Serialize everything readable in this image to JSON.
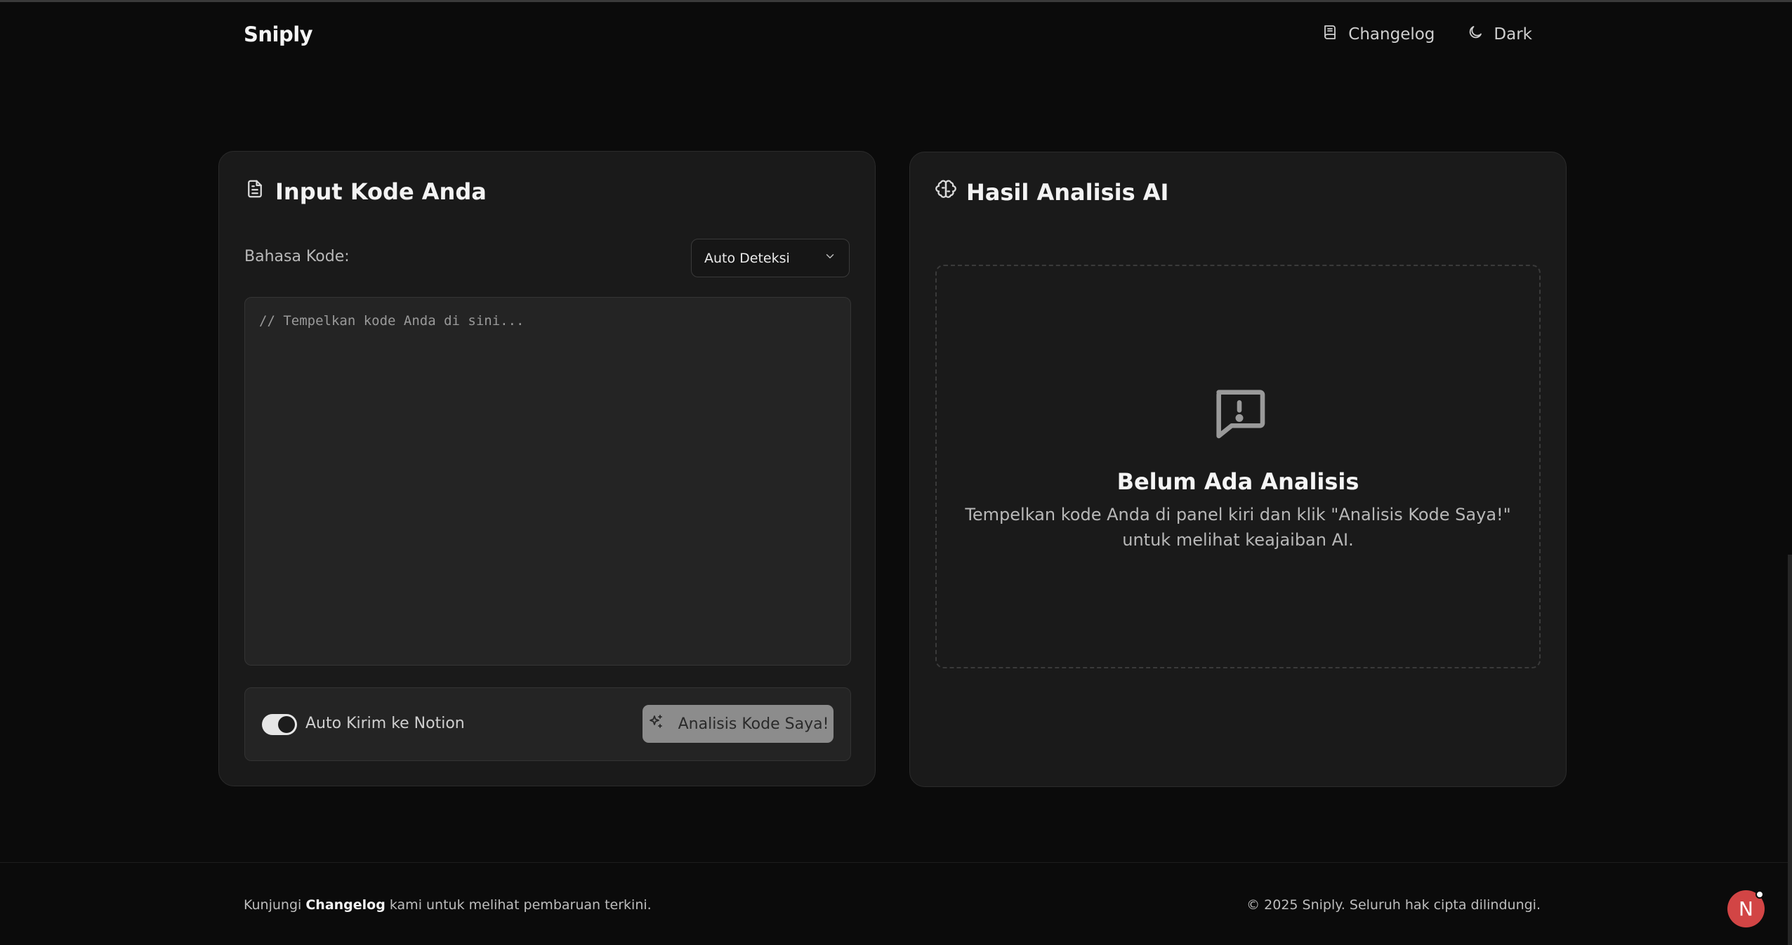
{
  "header": {
    "logo": "Sniply",
    "nav": [
      {
        "label": "Changelog",
        "icon": "book-icon"
      },
      {
        "label": "Dark",
        "icon": "moon-icon"
      }
    ]
  },
  "input_panel": {
    "title": "Input Kode Anda",
    "title_icon": "document-icon",
    "language_label": "Bahasa Kode:",
    "language_selected": "Auto Deteksi",
    "code_placeholder": "// Tempelkan kode Anda di sini...",
    "code_value": "",
    "toggle": {
      "label": "Auto Kirim ke Notion",
      "on": true
    },
    "analyze_button": "Analisis Kode Saya!"
  },
  "result_panel": {
    "title": "Hasil Analisis AI",
    "title_icon": "brain-icon",
    "empty_title": "Belum Ada Analisis",
    "empty_description": "Tempelkan kode Anda di panel kiri dan klik \"Analisis Kode Saya!\" untuk melihat keajaiban AI."
  },
  "footer": {
    "left_prefix": "Kunjungi ",
    "left_link": "Changelog",
    "left_suffix": " kami untuk melihat pembaruan terkini.",
    "right": "© 2025 Sniply. Seluruh hak cipta dilindungi."
  },
  "avatar": {
    "letter": "N",
    "color": "#d24545"
  },
  "colors": {
    "background": "#0b0b0b",
    "panel": "#1a1a1a",
    "button_disabled": "#8c8c8c"
  }
}
